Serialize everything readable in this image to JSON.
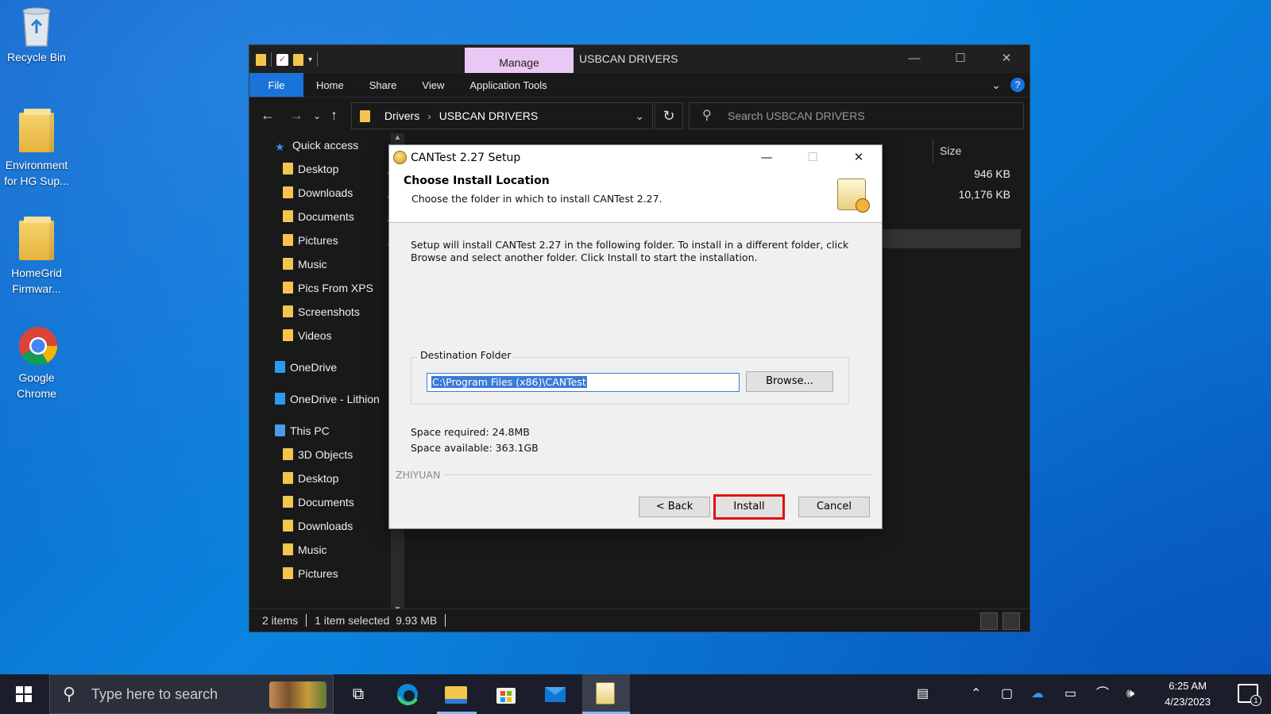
{
  "desktop": {
    "icons": [
      {
        "label": "Recycle Bin"
      },
      {
        "label": "Environment for HG Sup..."
      },
      {
        "label": "HomeGrid Firmwar..."
      },
      {
        "label": "Google Chrome"
      }
    ]
  },
  "explorer": {
    "contextual_tab": "Manage",
    "window_title": "USBCAN DRIVERS",
    "ribbon_tabs": [
      "File",
      "Home",
      "Share",
      "View",
      "Application Tools"
    ],
    "breadcrumb": [
      "Drivers",
      "USBCAN DRIVERS"
    ],
    "search_placeholder": "Search USBCAN DRIVERS",
    "nav_items": [
      {
        "label": "Quick access",
        "icon": "star-icon",
        "indent": false,
        "pinned": false
      },
      {
        "label": "Desktop",
        "icon": "desktop-folder-icon",
        "indent": true,
        "pinned": true
      },
      {
        "label": "Downloads",
        "icon": "downloads-folder-icon",
        "indent": true,
        "pinned": true
      },
      {
        "label": "Documents",
        "icon": "documents-folder-icon",
        "indent": true,
        "pinned": true
      },
      {
        "label": "Pictures",
        "icon": "pictures-folder-icon",
        "indent": true,
        "pinned": true
      },
      {
        "label": "Music",
        "icon": "music-folder-icon",
        "indent": true,
        "pinned": false
      },
      {
        "label": "Pics From XPS",
        "icon": "folder-icon",
        "indent": true,
        "pinned": false
      },
      {
        "label": "Screenshots",
        "icon": "folder-icon",
        "indent": true,
        "pinned": false
      },
      {
        "label": "Videos",
        "icon": "videos-folder-icon",
        "indent": true,
        "pinned": false
      },
      {
        "label": "OneDrive",
        "icon": "cloud-icon",
        "indent": false,
        "pinned": false
      },
      {
        "label": "OneDrive - Lithion",
        "icon": "cloud-icon",
        "indent": false,
        "pinned": false
      },
      {
        "label": "This PC",
        "icon": "computer-icon",
        "indent": false,
        "pinned": false
      },
      {
        "label": "3D Objects",
        "icon": "folder-icon",
        "indent": true,
        "pinned": false
      },
      {
        "label": "Desktop",
        "icon": "desktop-folder-icon",
        "indent": true,
        "pinned": false
      },
      {
        "label": "Documents",
        "icon": "documents-folder-icon",
        "indent": true,
        "pinned": false
      },
      {
        "label": "Downloads",
        "icon": "downloads-folder-icon",
        "indent": true,
        "pinned": false
      },
      {
        "label": "Music",
        "icon": "music-folder-icon",
        "indent": true,
        "pinned": false
      },
      {
        "label": "Pictures",
        "icon": "pictures-folder-icon",
        "indent": true,
        "pinned": false
      }
    ],
    "size_header": "Size",
    "file_sizes": [
      "946 KB",
      "10,176 KB"
    ],
    "status": {
      "items": "2 items",
      "selected": "1 item selected",
      "size": "9.93 MB"
    }
  },
  "setup": {
    "title": "CANTest 2.27 Setup",
    "heading": "Choose Install Location",
    "subheading": "Choose the folder in which to install CANTest 2.27.",
    "intro": "Setup will install CANTest 2.27 in the following folder. To install in a different folder, click Browse and select another folder. Click Install to start the installation.",
    "destination_label": "Destination Folder",
    "destination_path": "C:\\Program Files (x86)\\CANTest",
    "browse_label": "Browse...",
    "space_required": "Space required: 24.8MB",
    "space_available": "Space available: 363.1GB",
    "brand": "ZHIYUAN",
    "back_label": "< Back",
    "install_label": "Install",
    "cancel_label": "Cancel"
  },
  "taskbar": {
    "search_placeholder": "Type here to search",
    "time": "6:25 AM",
    "date": "4/23/2023",
    "notification_count": "1"
  },
  "colors": {
    "accent": "#1a73d8",
    "highlight_box": "#e31010",
    "manage_tab": "#e9c8f5"
  }
}
